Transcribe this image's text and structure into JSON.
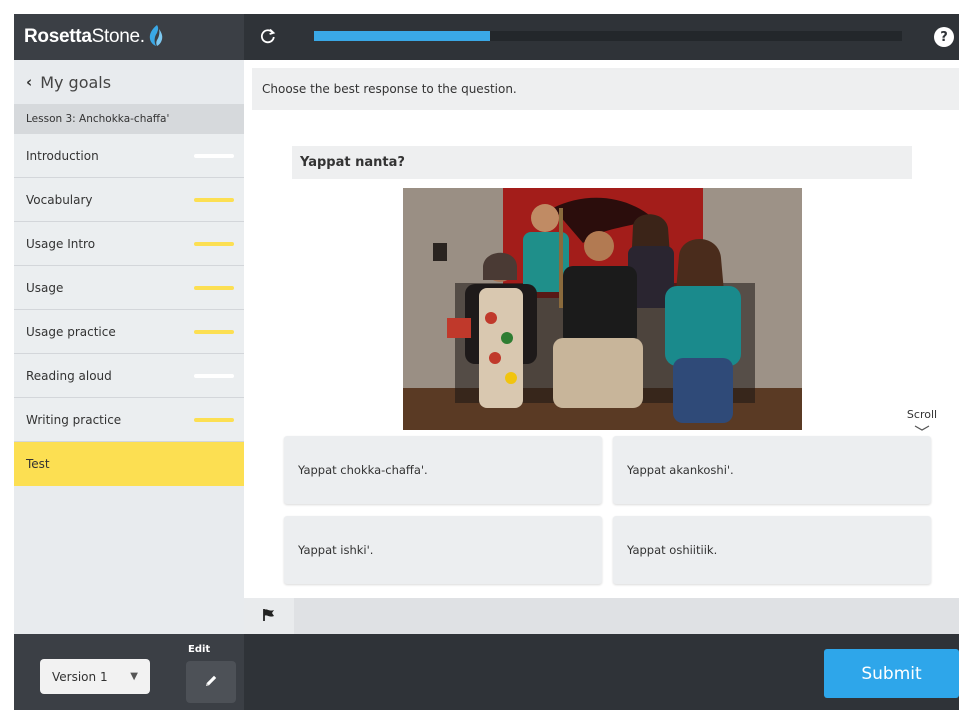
{
  "brand": {
    "name_bold": "Rosetta",
    "name_rest": "Stone",
    "name_dot": "."
  },
  "sidebar": {
    "back_label": "My goals",
    "lesson_title": "Lesson 3: Anchokka-chaffa'",
    "items": [
      {
        "label": "Introduction",
        "progress_color": "#ffffff",
        "active": false
      },
      {
        "label": "Vocabulary",
        "progress_color": "#fcdf52",
        "active": false
      },
      {
        "label": "Usage Intro",
        "progress_color": "#fcdf52",
        "active": false
      },
      {
        "label": "Usage",
        "progress_color": "#fcdf52",
        "active": false
      },
      {
        "label": "Usage practice",
        "progress_color": "#fcdf52",
        "active": false
      },
      {
        "label": "Reading aloud",
        "progress_color": "#ffffff",
        "active": false
      },
      {
        "label": "Writing practice",
        "progress_color": "#fcdf52",
        "active": false
      },
      {
        "label": "Test",
        "progress_color": "",
        "active": true
      }
    ],
    "version_selected": "Version 1",
    "edit_label": "Edit"
  },
  "topbar": {
    "progress_fraction": 0.3,
    "help_symbol": "?"
  },
  "lesson": {
    "instruction": "Choose the best response to the question.",
    "question": "Yappat nanta?",
    "scroll_label": "Scroll",
    "answers": [
      "Yappat chokka-chaffa'.",
      "Yappat akankoshi'.",
      "Yappat ishki'.",
      "Yappat oshiitiik."
    ]
  },
  "actions": {
    "submit_label": "Submit"
  },
  "colors": {
    "accent_blue": "#2ea6ea",
    "active_yellow": "#fcdf52",
    "dark_bar": "#2f3338"
  },
  "icons": {
    "back": "chevron-left-icon",
    "refresh": "refresh-icon",
    "help": "help-icon",
    "flag": "flag-icon",
    "edit": "pencil-icon",
    "dropdown": "caret-down-icon",
    "scroll": "chevron-down-icon"
  }
}
